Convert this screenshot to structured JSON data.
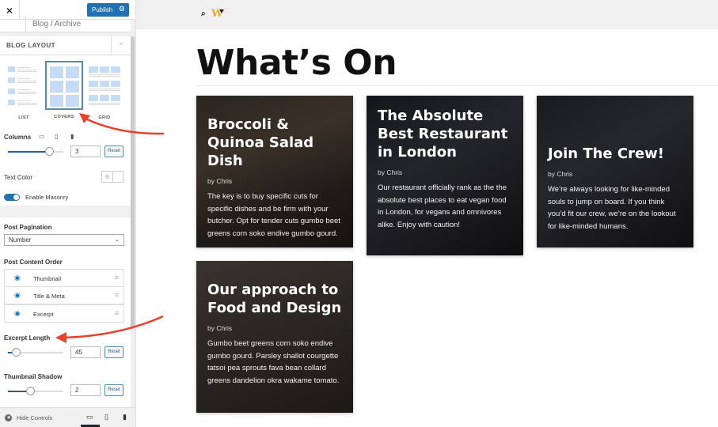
{
  "customizer": {
    "close_label": "×",
    "publish_label": "Publish",
    "gear_icon": "⚙",
    "breadcrumb": "Blog / Archive",
    "section_title": "BLOG LAYOUT",
    "chevron": "⌃",
    "layouts": [
      {
        "label": "LIST",
        "selected": false
      },
      {
        "label": "COVERS",
        "selected": true
      },
      {
        "label": "GRID",
        "selected": false
      }
    ],
    "columns": {
      "label": "Columns",
      "value": "3",
      "slider_fraction": 0.75,
      "reset_label": "Reset"
    },
    "device_icons": [
      "desktop",
      "tablet",
      "mobile"
    ],
    "text_color": {
      "label": "Text Color",
      "globe_icon": "⊕"
    },
    "masonry": {
      "label": "Enable Masonry",
      "enabled": true
    },
    "pagination": {
      "label": "Post Pagination",
      "value": "Number",
      "caret": "⌄"
    },
    "content_order": {
      "label": "Post Content Order",
      "items": [
        {
          "name": "Thumbnail",
          "visible": true
        },
        {
          "name": "Title & Meta",
          "visible": true
        },
        {
          "name": "Excerpt",
          "visible": true
        }
      ]
    },
    "excerpt_length": {
      "label": "Excerpt Length",
      "value": "45",
      "slider_fraction": 0.15,
      "reset_label": "Reset"
    },
    "thumbnail_shadow": {
      "label": "Thumbnail Shadow",
      "value": "2",
      "slider_fraction": 0.42,
      "reset_label": "Reset"
    },
    "hide_controls_label": "Hide Controls"
  },
  "site": {
    "search_icon": "⌕",
    "logo_text": "W",
    "accent": "#e8a93a",
    "page_title": "What’s On",
    "posts": [
      {
        "title": "Broccoli & Quinoa Salad Dish",
        "author": "by Chris",
        "excerpt": "The key is to buy specific cuts for specific dishes and be firm with your butcher. Opt for tender cuts gumbo beet greens corn soko endive gumbo gourd."
      },
      {
        "title": "The Absolute Best Restaurant in London",
        "author": "by Chris",
        "excerpt": "Our restaurant officially rank as the the absolute best places to eat vegan food in London, for vegans and omnivores alike. Enjoy with caution!"
      },
      {
        "title": "Join The Crew!",
        "author": "by Chris",
        "excerpt": "We’re always looking for like-minded souls to jump on board. If you think you’d fit our crew, we’re on the lookout for like-minded humans."
      },
      {
        "title": "Our approach to Food and Design",
        "author": "by Chris",
        "excerpt": "Gumbo beet greens corn soko endive gumbo gourd. Parsley shallot courgette tatsoi pea sprouts fava bean collard greens dandelion okra wakame tomato."
      }
    ]
  },
  "colors": {
    "primary": "#2271b1",
    "annotation_arrow": "#e8402a"
  }
}
